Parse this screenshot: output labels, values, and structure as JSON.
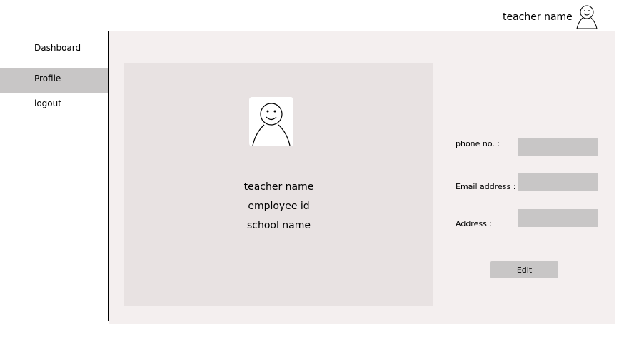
{
  "header": {
    "user_name": "teacher name",
    "avatar_icon": "user-avatar-icon"
  },
  "sidebar": {
    "items": [
      {
        "label": "Dashboard",
        "active": false
      },
      {
        "label": "Profile",
        "active": true
      },
      {
        "label": "logout",
        "active": false
      }
    ]
  },
  "profile": {
    "avatar_icon": "user-avatar-icon",
    "name": "teacher name",
    "employee_id": "employee id",
    "school": "school name"
  },
  "form": {
    "phone_label": "phone no. :",
    "phone_value": "",
    "email_label": "Email address :",
    "email_value": "",
    "address_label": "Address :",
    "address_value": "",
    "edit_label": "Edit"
  },
  "colors": {
    "main_bg": "#f4efef",
    "card_bg": "#e8e2e2",
    "control_gray": "#c8c6c6"
  }
}
